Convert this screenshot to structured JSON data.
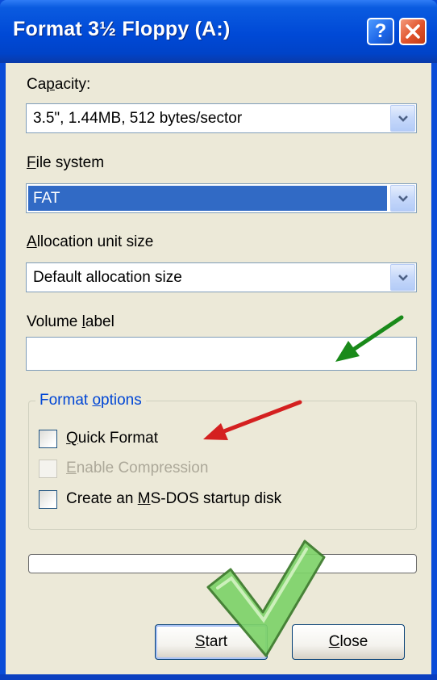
{
  "window": {
    "title": "Format 3½ Floppy (A:)",
    "help_symbol": "?",
    "accent_color": "#0a4cd8"
  },
  "capacity": {
    "label_pre": "Ca",
    "label_key": "p",
    "label_post": "acity:",
    "value": "3.5\",  1.44MB, 512 bytes/sector"
  },
  "file_system": {
    "label_key": "F",
    "label_post": "ile system",
    "value": "FAT"
  },
  "allocation": {
    "label_key": "A",
    "label_post": "llocation unit size",
    "value": "Default allocation size"
  },
  "volume_label": {
    "label_pre": "Volume ",
    "label_key": "l",
    "label_post": "abel",
    "value": ""
  },
  "format_options": {
    "title_pre": "Format ",
    "title_key": "o",
    "title_post": "ptions",
    "quick_format": {
      "key": "Q",
      "rest": "uick Format",
      "checked": false
    },
    "enable_compression": {
      "key": "E",
      "rest": "nable Compression",
      "checked": false,
      "enabled": false
    },
    "msdos_startup": {
      "pre": "Create an ",
      "key": "M",
      "rest": "S-DOS startup disk",
      "checked": false
    }
  },
  "progress": {
    "value": 0
  },
  "buttons": {
    "start": {
      "key": "S",
      "rest": "tart"
    },
    "close": {
      "key": "C",
      "rest": "lose"
    }
  },
  "annotations": {
    "green_arrow_color": "#1a8a1a",
    "red_arrow_color": "#d42020",
    "checkmark_color": "#7ed36a"
  }
}
